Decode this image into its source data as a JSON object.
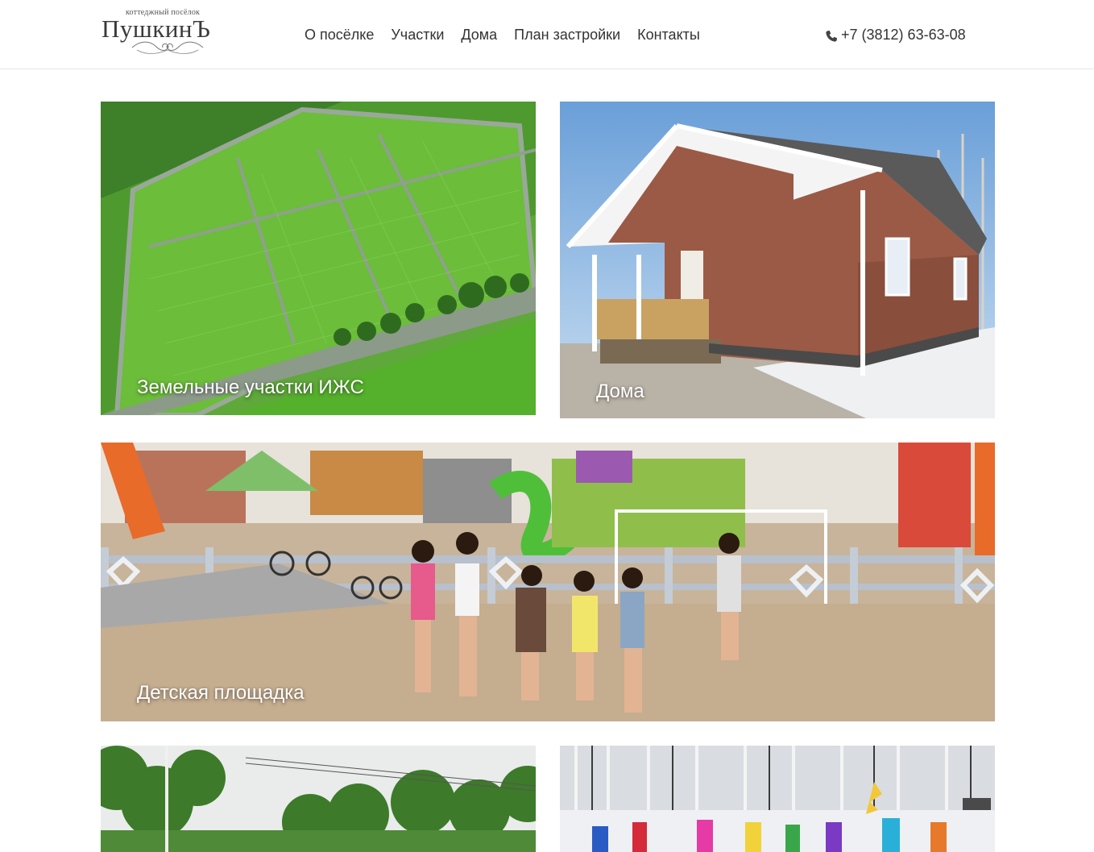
{
  "header": {
    "logo": {
      "small_text": "коттеджный посёлок",
      "big_text": "ПушкинЪ"
    },
    "nav": [
      {
        "label": "О посёлке"
      },
      {
        "label": "Участки"
      },
      {
        "label": "Дома"
      },
      {
        "label": "План застройки"
      },
      {
        "label": "Контакты"
      }
    ],
    "phone": {
      "icon": "phone-icon",
      "number": "+7 (3812) 63-63-08"
    }
  },
  "cards": {
    "plots": {
      "caption": "Земельные участки ИЖС"
    },
    "houses": {
      "caption": "Дома"
    },
    "playground": {
      "caption": "Детская площадка"
    },
    "forest": {
      "caption": ""
    },
    "winter": {
      "caption": ""
    }
  },
  "colors": {
    "caption_text": "#ffffff",
    "nav_text": "#333333",
    "header_border": "#e5e5e5"
  }
}
